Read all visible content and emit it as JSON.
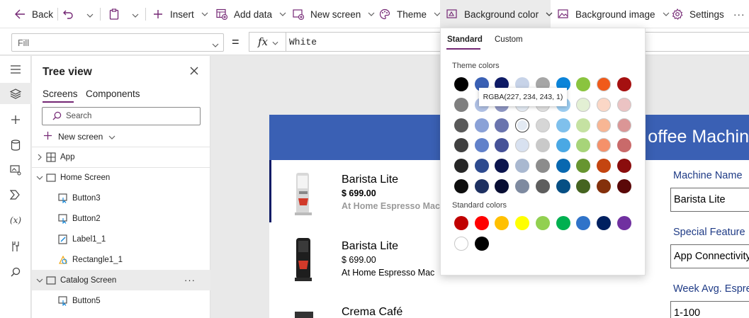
{
  "toolbar": {
    "back_label": "Back",
    "insert_label": "Insert",
    "add_data_label": "Add data",
    "new_screen_label": "New screen",
    "theme_label": "Theme",
    "background_color_label": "Background color",
    "background_image_label": "Background image",
    "settings_label": "Settings",
    "more_label": "···"
  },
  "formula_bar": {
    "property": "Fill",
    "equals": "=",
    "fx_label": "fx",
    "formula": "White"
  },
  "rail": {
    "icons": [
      "hamburger-icon",
      "layers-icon",
      "plus-icon",
      "database-icon",
      "media-icon",
      "power-automate-icon",
      "variables-icon",
      "tools-icon",
      "search-icon"
    ],
    "variables_text": "(x)"
  },
  "tree_view": {
    "title": "Tree view",
    "tabs": [
      "Screens",
      "Components"
    ],
    "search_placeholder": "Search",
    "new_screen_label": "New screen",
    "items": [
      {
        "label": "App",
        "type": "app"
      },
      {
        "label": "Home Screen",
        "type": "screen"
      },
      {
        "label": "Button3",
        "type": "button"
      },
      {
        "label": "Button2",
        "type": "button"
      },
      {
        "label": "Label1_1",
        "type": "label"
      },
      {
        "label": "Rectangle1_1",
        "type": "rectangle"
      },
      {
        "label": "Catalog Screen",
        "type": "screen",
        "selected": true
      },
      {
        "label": "Button5",
        "type": "button"
      }
    ],
    "row_more": "···"
  },
  "canvas": {
    "header_title": "offee Machin",
    "header_color": "#3a60b4",
    "products": [
      {
        "name": "Barista Lite",
        "price": "$ 699.00",
        "description": "At Home Espresso Mac",
        "selected": true
      },
      {
        "name": "Barista Lite",
        "price": "$ 699.00",
        "description": "At Home Espresso Mac",
        "selected": false
      },
      {
        "name": "Crema Café",
        "price": "",
        "description": "",
        "selected": false
      }
    ],
    "form": [
      {
        "label": "Machine Name",
        "value": "Barista Lite"
      },
      {
        "label": "Special Feature",
        "value": "App Connectivity"
      },
      {
        "label": "Week Avg. Espre",
        "value": "1-100"
      }
    ]
  },
  "color_flyout": {
    "tabs": [
      "Standard",
      "Custom"
    ],
    "active_tab": "Standard",
    "theme_colors_label": "Theme colors",
    "standard_colors_label": "Standard colors",
    "tooltip": "RGBA(227, 234, 243, 1)",
    "theme_columns": [
      [
        "#000000",
        "#7f7f7f",
        "#595959",
        "#404040",
        "#262626",
        "#0d0d0d"
      ],
      [
        "#3a60b4",
        "#b0c1e4",
        "#8aa1d7",
        "#6181ca",
        "#2d4a8f",
        "#1d3061"
      ],
      [
        "#0e1b66",
        "#8e96c2",
        "#6a74ae",
        "#465298",
        "#0b144d",
        "#070d33"
      ],
      [
        "#c7d3e8",
        "#e3eaf3",
        "#e3eaf3",
        "#d8e1f0",
        "#a9b8d0",
        "#7e8aa0"
      ],
      [
        "#a6a6a6",
        "#e0e0e0",
        "#d6d6d6",
        "#c9c9c9",
        "#8c8c8c",
        "#5e5e5e"
      ],
      [
        "#0b84d9",
        "#9ccdf0",
        "#7fc0ec",
        "#4aa8e4",
        "#0868b0",
        "#064f84"
      ],
      [
        "#8ac43f",
        "#e3f0d4",
        "#c5e2a2",
        "#a7d479",
        "#679530",
        "#456420"
      ],
      [
        "#f05a1a",
        "#fbd7c6",
        "#f8b694",
        "#f5916a",
        "#c44510",
        "#84300b"
      ],
      [
        "#a51010",
        "#ebc3c3",
        "#db9696",
        "#c96a6a",
        "#8a0d0d",
        "#5a0808"
      ]
    ],
    "standard_colors": [
      "#c00000",
      "#ff0000",
      "#ffc000",
      "#ffff00",
      "#92d050",
      "#00b050",
      "#2f73c9",
      "#002060",
      "#7030a0",
      "#ffffff",
      "#000000"
    ],
    "selected_swatch": "#e3eaf3"
  }
}
